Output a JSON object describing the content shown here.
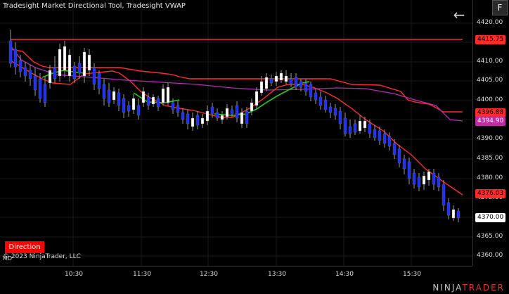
{
  "header": {
    "title": "Tradesight Market Directional Tool, Tradesight VWAP",
    "back_icon": "arrow-left-icon",
    "f_button": "F"
  },
  "overlay": {
    "md_label": "MD",
    "direction_button": "Direction",
    "copyright": "© 2023 NinjaTrader, LLC"
  },
  "axis": {
    "y_ticks": [
      "4420.00",
      "4415.00",
      "4410.00",
      "4405.00",
      "4400.00",
      "4395.00",
      "4390.00",
      "4385.00",
      "4380.00",
      "4375.00",
      "4370.00",
      "4365.00",
      "4360.00"
    ],
    "x_ticks": [
      "10:30",
      "11:30",
      "12:30",
      "13:30",
      "14:30",
      "15:30"
    ]
  },
  "badges": [
    {
      "text": "4415.75",
      "bg": "#ff2b2b",
      "fg": "#000"
    },
    {
      "text": "4396.88",
      "bg": "#ff2b2b",
      "fg": "#000"
    },
    {
      "text": "4394.90",
      "bg": "#c02aa3",
      "fg": "#fff"
    },
    {
      "text": "4376.03",
      "bg": "#ff2b2b",
      "fg": "#000"
    },
    {
      "text": "4370.00",
      "bg": "#ffffff",
      "fg": "#000"
    }
  ],
  "footer": {
    "logo_left": "NINJA",
    "logo_right": "TRADER"
  },
  "colors": {
    "background": "#000000",
    "up": "#ffffff",
    "down": "#1f2fff",
    "red_line": "#ff2a2a",
    "green_line": "#20d020",
    "vwap": "#b62ab6"
  }
}
